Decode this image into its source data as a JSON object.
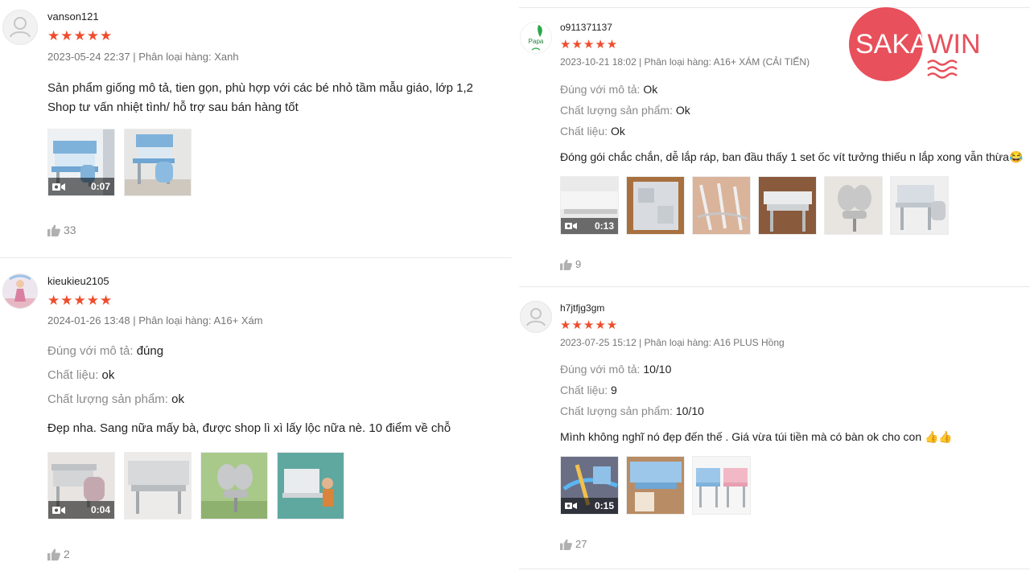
{
  "reviews_left": [
    {
      "username": "vanson121",
      "stars": "★★★★★",
      "meta": "2023-05-24 22:37 | Phân loại hàng: Xanh",
      "comment_lines": [
        "Sản phẩm giống mô tả, tien gọn, phù hợp với các bé nhỏ tầm mẫu giáo, lớp 1,2",
        "Shop tư vấn nhiệt tình/ hỗ trợ sau bán hàng tốt"
      ],
      "video_duration": "0:07",
      "likes": "33"
    },
    {
      "username": "kieukieu2105",
      "stars": "★★★★★",
      "meta": "2024-01-26 13:48 | Phân loại hàng: A16+ Xám",
      "attrs": [
        {
          "label": "Đúng với mô tả:",
          "value": "đúng"
        },
        {
          "label": "Chất liệu:",
          "value": "ok"
        },
        {
          "label": "Chất lượng sản phẩm:",
          "value": "ok"
        }
      ],
      "comment": "Đẹp nha. Sang nữa mấy bà, được shop lì xì lấy lộc nữa nè. 10 điểm về chỗ",
      "video_duration": "0:04",
      "likes": "2"
    }
  ],
  "reviews_right": [
    {
      "username": "o911371137",
      "stars": "★★★★★",
      "meta": "2023-10-21 18:02 | Phân loại hàng: A16+ XÁM (CẢI TIẾN)",
      "attrs": [
        {
          "label": "Đúng với mô tả:",
          "value": "Ok"
        },
        {
          "label": "Chất lượng sản phẩm:",
          "value": "Ok"
        },
        {
          "label": "Chất liệu:",
          "value": "Ok"
        }
      ],
      "comment": "Đóng gói chắc chắn, dễ lắp ráp, ban đầu thấy 1 set ốc vít tưởng thiếu n lắp xong vẫn thừa😂",
      "video_duration": "0:13",
      "likes": "9"
    },
    {
      "username": "h7jtfjg3gm",
      "stars": "★★★★★",
      "meta": "2023-07-25 15:12 | Phân loại hàng: A16 PLUS Hồng",
      "attrs": [
        {
          "label": "Đúng với mô tả:",
          "value": "10/10"
        },
        {
          "label": "Chất liệu:",
          "value": "9"
        },
        {
          "label": "Chất lượng sản phẩm:",
          "value": "10/10"
        }
      ],
      "comment": "Mình không nghĩ nó đẹp đến thế . Giá vừa túi tiền mà có bàn ok cho con 👍👍",
      "video_duration": "0:15",
      "likes": "27"
    }
  ],
  "logo": {
    "text": "SAKAWIN",
    "color": "#e8505b"
  },
  "avatar_badge_text": "Papa",
  "colors": {
    "star": "#ee4d2d",
    "meta": "#757575"
  }
}
